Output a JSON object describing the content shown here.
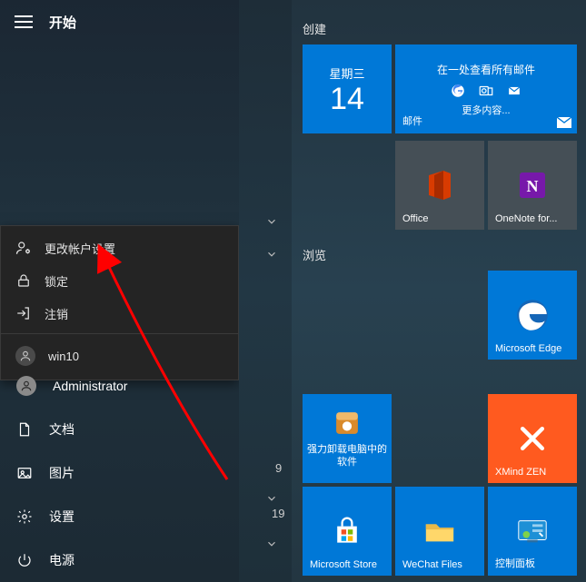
{
  "sidebar": {
    "title": "开始",
    "flyout": {
      "change_account": "更改帐户设置",
      "lock": "锁定",
      "sign_out": "注销",
      "user": "win10"
    },
    "items": {
      "admin": "Administrator",
      "documents": "文档",
      "pictures": "图片",
      "settings": "设置",
      "power": "电源"
    }
  },
  "applist": {
    "year_fragment_1": "9",
    "year_fragment_2": "19"
  },
  "groups": {
    "create": "创建",
    "browse": "浏览"
  },
  "tiles": {
    "calendar": {
      "weekday": "星期三",
      "day": "14"
    },
    "mail": {
      "headline": "在一处查看所有邮件",
      "more": "更多内容...",
      "caption": "邮件"
    },
    "office": "Office",
    "onenote": "OneNote for...",
    "edge": "Microsoft Edge",
    "uninstaller": "强力卸载电脑中的软件",
    "xmind": "XMind ZEN",
    "store": "Microsoft Store",
    "wechat": "WeChat Files",
    "control_panel": "控制面板"
  },
  "colors": {
    "accent": "#0078d7",
    "xmind": "#ff5a1f",
    "office": "#d83b01",
    "onenote": "#7719aa"
  }
}
